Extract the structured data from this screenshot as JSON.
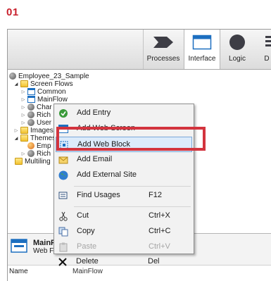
{
  "step_label": "01",
  "toolbar": {
    "tabs": [
      {
        "label": "Processes",
        "icon": "processes-arrow-icon"
      },
      {
        "label": "Interface",
        "icon": "interface-window-icon",
        "active": true
      },
      {
        "label": "Logic",
        "icon": "logic-circle-icon"
      },
      {
        "label": "D",
        "icon": "data-icon"
      }
    ]
  },
  "tree": {
    "items": [
      {
        "label": "Employee_23_Sample",
        "icon": "module-icon"
      },
      {
        "label": "Screen Flows",
        "icon": "folder-icon"
      },
      {
        "label": "Common",
        "icon": "flow-icon"
      },
      {
        "label": "MainFlow",
        "icon": "flow-icon"
      },
      {
        "label": "Char",
        "icon": "module-icon"
      },
      {
        "label": "Rich",
        "icon": "module-icon"
      },
      {
        "label": "User",
        "icon": "module-icon"
      },
      {
        "label": "Images",
        "icon": "folder-icon"
      },
      {
        "label": "Themes",
        "icon": "folder-icon"
      },
      {
        "label": "Emp",
        "icon": "theme-icon"
      },
      {
        "label": "Rich",
        "icon": "module-icon"
      },
      {
        "label": "Multiling",
        "icon": "folder-icon"
      }
    ]
  },
  "context_menu": {
    "items": [
      {
        "label": "Add Entry",
        "icon": "add-entry-icon",
        "shortcut": ""
      },
      {
        "label": "Add Web Screen",
        "icon": "web-screen-icon",
        "shortcut": ""
      },
      {
        "label": "Add Web Block",
        "icon": "web-block-icon",
        "shortcut": "",
        "highlighted": true
      },
      {
        "label": "Add Email",
        "icon": "email-icon",
        "shortcut": ""
      },
      {
        "label": "Add External Site",
        "icon": "globe-icon",
        "shortcut": ""
      },
      {
        "label": "Find Usages",
        "icon": "find-usages-icon",
        "shortcut": "F12"
      },
      {
        "label": "Cut",
        "icon": "scissors-icon",
        "shortcut": "Ctrl+X"
      },
      {
        "label": "Copy",
        "icon": "copy-icon",
        "shortcut": "Ctrl+C"
      },
      {
        "label": "Paste",
        "icon": "paste-icon",
        "shortcut": "Ctrl+V",
        "disabled": true
      },
      {
        "label": "Delete",
        "icon": "delete-x-icon",
        "shortcut": "Del"
      }
    ]
  },
  "bottom_panel": {
    "title": "MainFlow",
    "subtitle": "Web Flow",
    "prop_name": "Name",
    "prop_value": "MainFlow"
  },
  "colors": {
    "step_label": "#c8202c",
    "highlight_border": "#d3343e",
    "selected_item_bg": "#dcebfb",
    "accent_blue": "#1d6fc0"
  }
}
